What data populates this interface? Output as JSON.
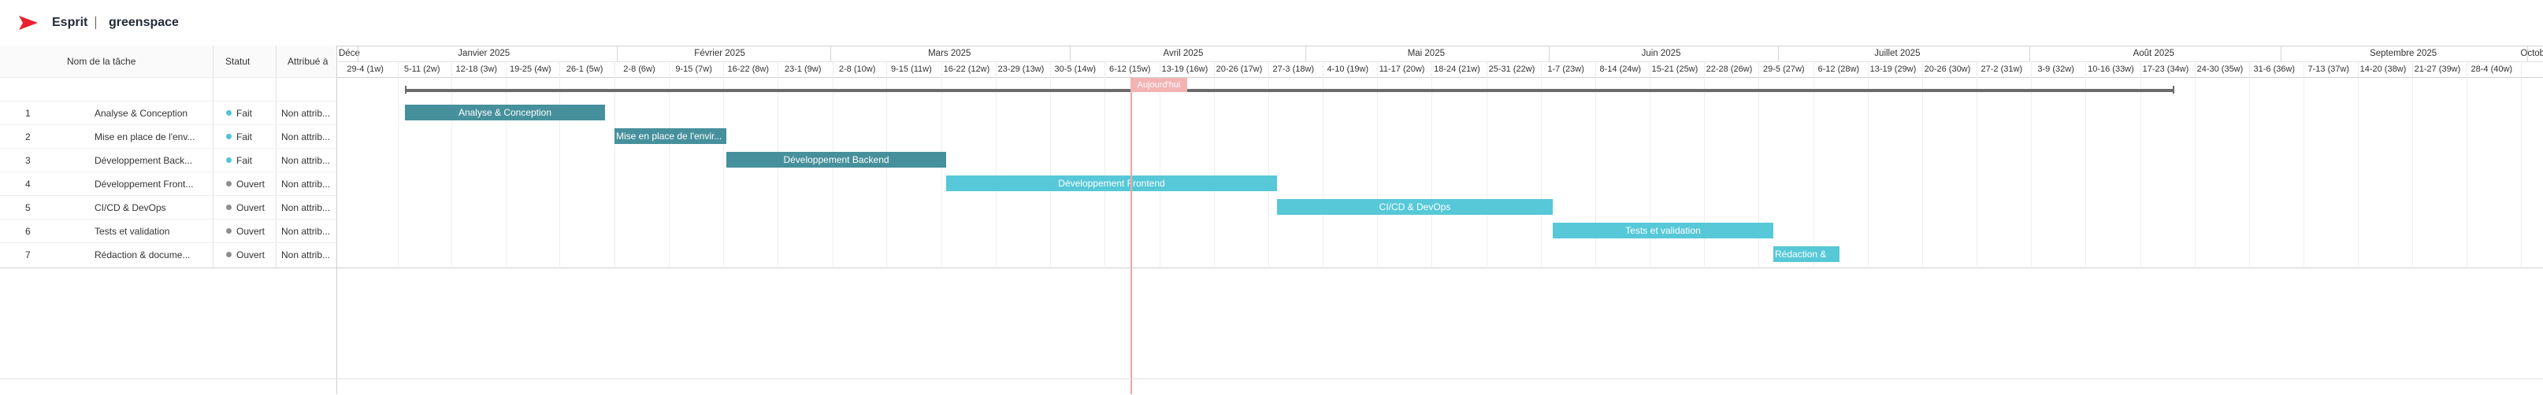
{
  "header": {
    "brand": "Esprit",
    "project": "greenspace",
    "logo_color": "#e8212e"
  },
  "table": {
    "columns": [
      "Nom de la tâche",
      "Statut",
      "Attribué à"
    ],
    "rows": [
      {
        "num": "1",
        "name": "Analyse & Conception",
        "status": "Fait",
        "status_color": "#4fc3d3",
        "assignee": "Non attrib..."
      },
      {
        "num": "2",
        "name": "Mise en place de l'env...",
        "status": "Fait",
        "status_color": "#4fc3d3",
        "assignee": "Non attrib..."
      },
      {
        "num": "3",
        "name": "Développement Back...",
        "status": "Fait",
        "status_color": "#4fc3d3",
        "assignee": "Non attrib..."
      },
      {
        "num": "4",
        "name": "Développement Front...",
        "status": "Ouvert",
        "status_color": "#8e8e8e",
        "assignee": "Non attrib..."
      },
      {
        "num": "5",
        "name": "CI/CD & DevOps",
        "status": "Ouvert",
        "status_color": "#8e8e8e",
        "assignee": "Non attrib..."
      },
      {
        "num": "6",
        "name": "Tests et validation",
        "status": "Ouvert",
        "status_color": "#8e8e8e",
        "assignee": "Non attrib..."
      },
      {
        "num": "7",
        "name": "Rédaction & docume...",
        "status": "Ouvert",
        "status_color": "#8e8e8e",
        "assignee": "Non attrib..."
      }
    ]
  },
  "timeline": {
    "months": [
      "Déce",
      "Janvier 2025",
      "Février 2025",
      "Mars 2025",
      "Avril 2025",
      "Mai 2025",
      "Juin 2025",
      "Juillet 2025",
      "Août 2025",
      "Septembre 2025",
      "Octobr"
    ],
    "weeks": [
      "29-4 (1w)",
      "5-11 (2w)",
      "12-18 (3w)",
      "19-25 (4w)",
      "26-1 (5w)",
      "2-8 (6w)",
      "9-15 (7w)",
      "16-22 (8w)",
      "23-1 (9w)",
      "2-8 (10w)",
      "9-15 (11w)",
      "16-22 (12w)",
      "23-29 (13w)",
      "30-5 (14w)",
      "6-12 (15w)",
      "13-19 (16w)",
      "20-26 (17w)",
      "27-3 (18w)",
      "4-10 (19w)",
      "11-17 (20w)",
      "18-24 (21w)",
      "25-31 (22w)",
      "1-7 (23w)",
      "8-14 (24w)",
      "15-21 (25w)",
      "22-28 (26w)",
      "29-5 (27w)",
      "6-12 (28w)",
      "13-19 (29w)",
      "20-26 (30w)",
      "27-2 (31w)",
      "3-9 (32w)",
      "10-16 (33w)",
      "17-23 (34w)",
      "24-30 (35w)",
      "31-6 (36w)",
      "7-13 (37w)",
      "14-20 (38w)",
      "21-27 (39w)",
      "28-4 (40w)"
    ],
    "today_label": "Aujourd'hui",
    "today_color": "#f3a3a3",
    "bar_colors": {
      "done": "#46909c",
      "open": "#56c8d8"
    },
    "tasks": [
      {
        "label": "Analyse & Conception",
        "status": "done"
      },
      {
        "label": "Mise en place de l'envir...",
        "status": "done"
      },
      {
        "label": "Développement Backend",
        "status": "done"
      },
      {
        "label": "Développement Frontend",
        "status": "open"
      },
      {
        "label": "CI/CD & DevOps",
        "status": "open"
      },
      {
        "label": "Tests et validation",
        "status": "open"
      },
      {
        "label": "Rédaction &",
        "status": "open"
      }
    ]
  }
}
